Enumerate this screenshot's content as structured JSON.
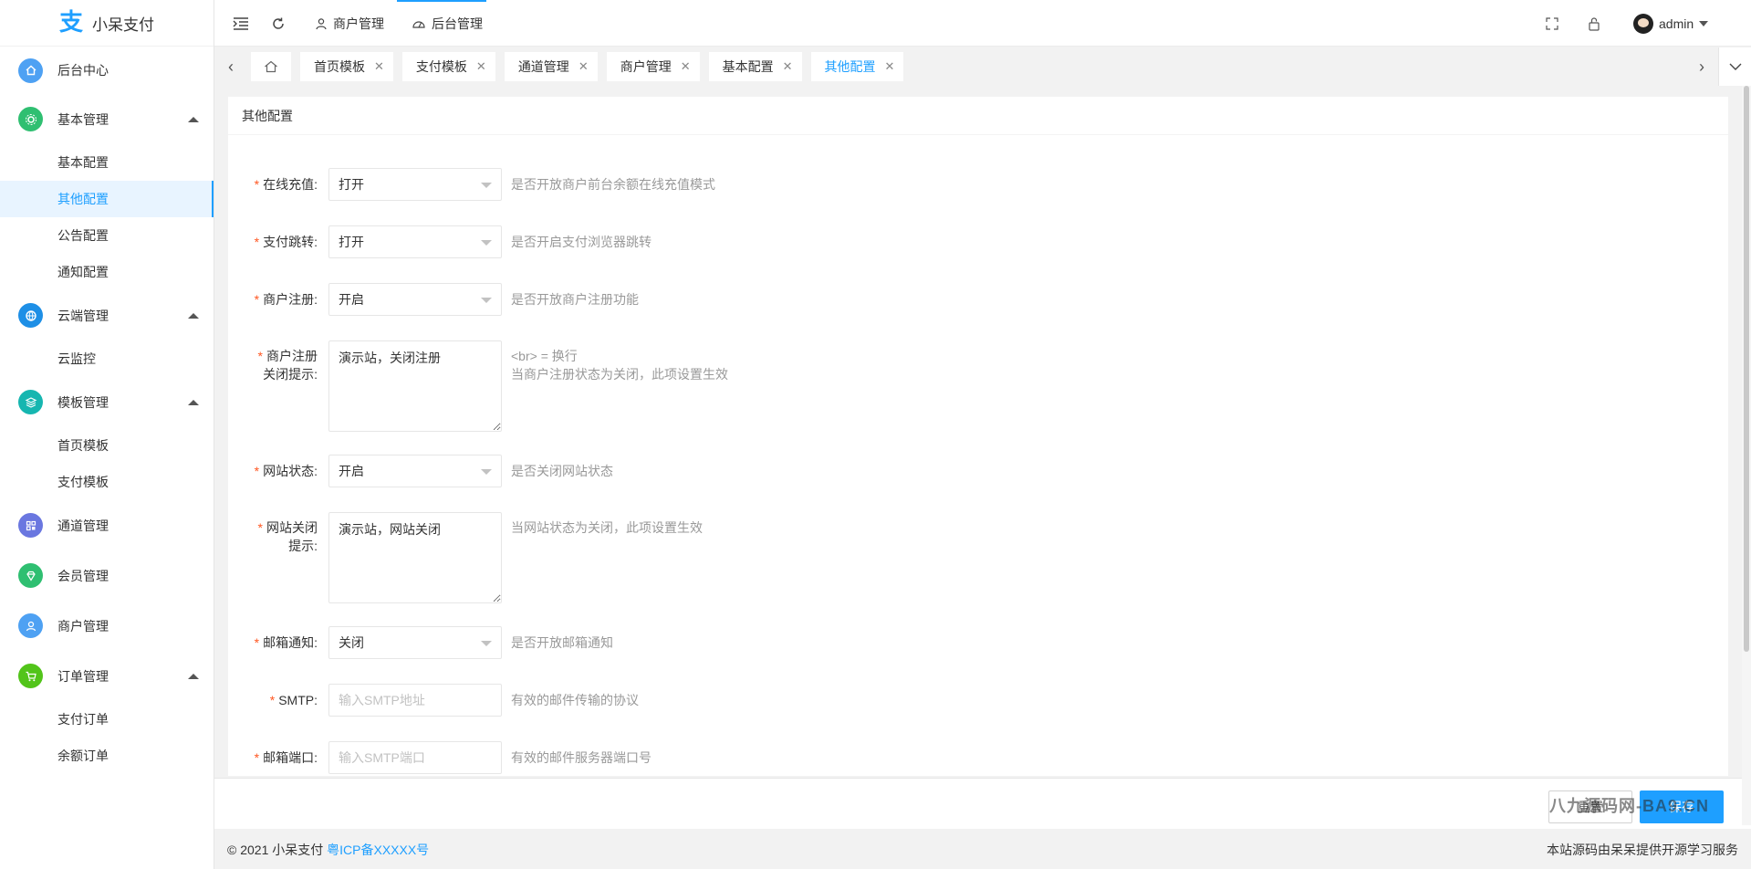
{
  "app": {
    "logo_char": "支",
    "name": "小呆支付"
  },
  "sidebar": {
    "home": {
      "label": "后台中心",
      "icon": "home-icon",
      "color": "#4ea1f3"
    },
    "groups": [
      {
        "label": "基本管理",
        "icon": "settings-icon",
        "color": "#2fbf71",
        "expanded": true,
        "items": [
          "基本配置",
          "其他配置",
          "公告配置",
          "通知配置"
        ]
      },
      {
        "label": "云端管理",
        "icon": "cloud-icon",
        "color": "#1e8fe6",
        "expanded": true,
        "items": [
          "云监控"
        ]
      },
      {
        "label": "模板管理",
        "icon": "layers-icon",
        "color": "#16b6b0",
        "expanded": true,
        "items": [
          "首页模板",
          "支付模板"
        ]
      },
      {
        "label": "通道管理",
        "icon": "grid-icon",
        "color": "#6a77e0"
      },
      {
        "label": "会员管理",
        "icon": "diamond-icon",
        "color": "#2fbf71"
      },
      {
        "label": "商户管理",
        "icon": "user-icon",
        "color": "#4ea1f3"
      },
      {
        "label": "订单管理",
        "icon": "cart-icon",
        "color": "#52c41a",
        "expanded": true,
        "items": [
          "支付订单",
          "余额订单"
        ]
      }
    ],
    "active_item": "其他配置"
  },
  "header": {
    "merchant_label": "商户管理",
    "admin_label": "后台管理",
    "user": "admin"
  },
  "tabs": [
    {
      "label": "首页模板"
    },
    {
      "label": "支付模板"
    },
    {
      "label": "通道管理"
    },
    {
      "label": "商户管理"
    },
    {
      "label": "基本配置"
    },
    {
      "label": "其他配置",
      "active": true
    }
  ],
  "card": {
    "title": "其他配置"
  },
  "form": {
    "online_recharge": {
      "label": "在线充值",
      "value": "打开",
      "hint": "是否开放商户前台余额在线充值模式"
    },
    "pay_redirect": {
      "label": "支付跳转",
      "value": "打开",
      "hint": "是否开启支付浏览器跳转"
    },
    "merchant_register": {
      "label": "商户注册",
      "value": "开启",
      "hint": "是否开放商户注册功能"
    },
    "register_close_tip": {
      "label_line1": "商户注册",
      "label_line2": "关闭提示",
      "value": "演示站，关闭注册",
      "hint_line1": "<br> = 换行",
      "hint_line2": "当商户注册状态为关闭，此项设置生效"
    },
    "site_status": {
      "label": "网站状态",
      "value": "开启",
      "hint": "是否关闭网站状态"
    },
    "site_close_tip": {
      "label_line1": "网站关闭",
      "label_line2": "提示",
      "value": "演示站，网站关闭",
      "hint": "当网站状态为关闭，此项设置生效"
    },
    "mail_notify": {
      "label": "邮箱通知",
      "value": "关闭",
      "hint": "是否开放邮箱通知"
    },
    "smtp": {
      "label": "SMTP",
      "placeholder": "输入SMTP地址",
      "hint": "有效的邮件传输的协议"
    },
    "mail_port": {
      "label": "邮箱端口",
      "placeholder": "输入SMTP端口",
      "hint": "有效的邮件服务器端口号"
    }
  },
  "actions": {
    "reset": "重置",
    "save": "保存",
    "watermark": "八九源码网-BA9.CN"
  },
  "footer": {
    "copyright": "© 2021 小呆支付",
    "icp": "粤ICP备XXXXX号",
    "right_text": "本站源码由呆呆提供开源学习服务"
  }
}
